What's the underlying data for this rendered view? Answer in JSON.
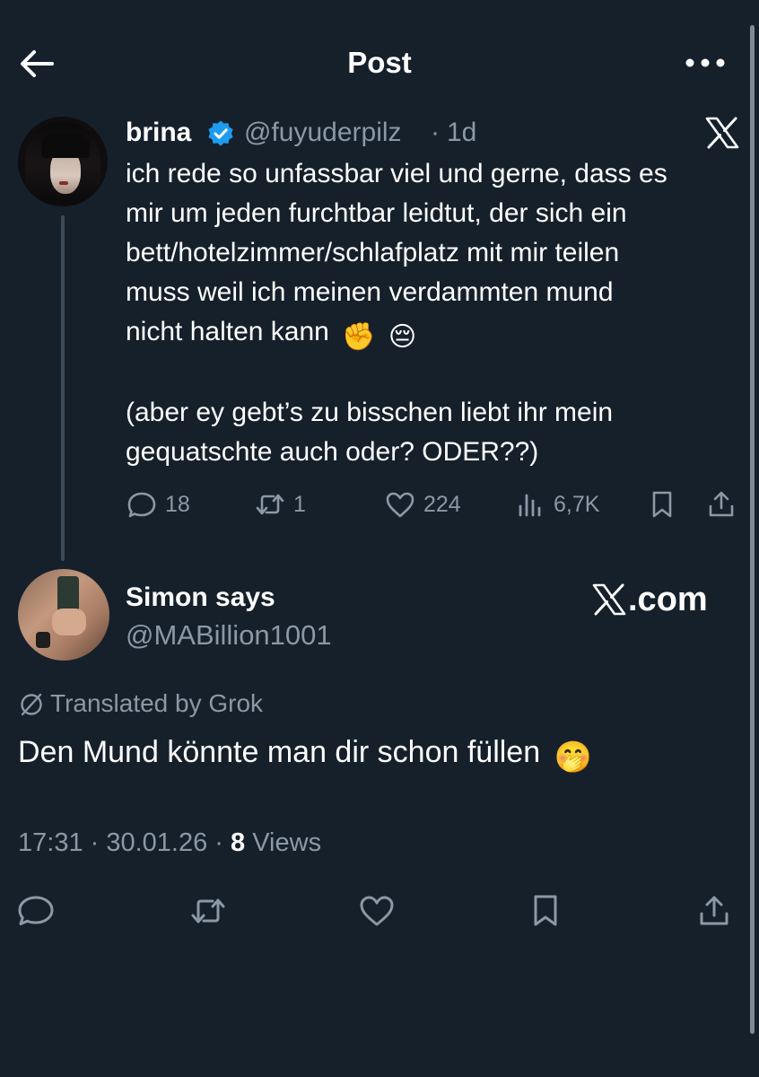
{
  "header": {
    "title": "Post",
    "back_icon": "arrow-left-icon",
    "more_icon": "more-horizontal-icon"
  },
  "quoted_post": {
    "author_name": "brina",
    "handle": "@fuyuderpilz",
    "separator": "·",
    "time": "1d",
    "verified": true,
    "text_lines": [
      "ich rede so unfassbar viel und gerne, dass es",
      "mir um jeden furchtbar leidtut, der sich ein",
      "bett/hotelzimmer/schlafplatz mit mir teilen",
      "muss weil ich meinen verdammten mund",
      "nicht halten kann",
      "(aber ey gebt’s zu bisschen liebt ihr mein",
      "gequatschte auch oder? ODER??)"
    ],
    "emojis": [
      "✊",
      "😔"
    ],
    "stats": {
      "replies": "18",
      "reposts": "1",
      "likes": "224",
      "views": "6,7K"
    }
  },
  "reply": {
    "author_name": "Simon says",
    "handle": "@MABillion1001",
    "watermark": ".com",
    "translated_label": "Translated by Grok",
    "text": "Den Mund könnte man dir schon füllen",
    "emoji": "🤭",
    "time": "17:31",
    "date": "30.01.26",
    "views_count": "8",
    "views_label": "Views"
  },
  "colors": {
    "background": "#15202b",
    "text_primary": "#ffffff",
    "text_secondary": "#8b98a5",
    "verified_blue": "#1d9bf0",
    "thread_line": "#3d4b59"
  }
}
